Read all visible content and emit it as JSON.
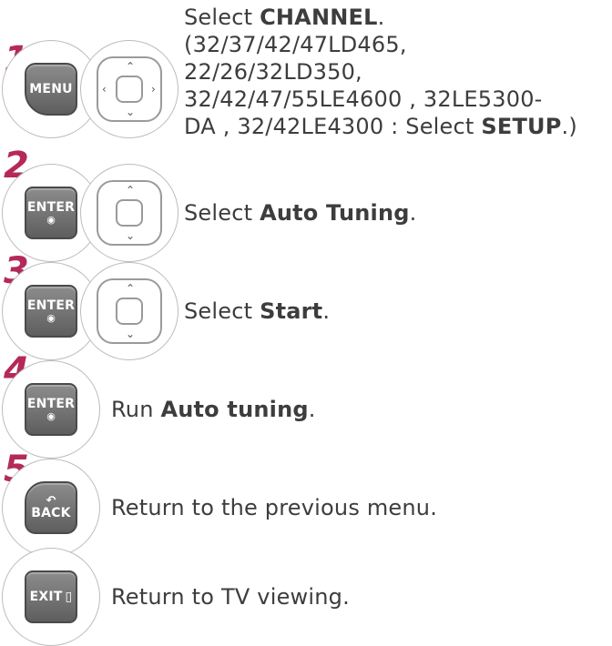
{
  "steps": [
    {
      "number": "1",
      "key": "MENU",
      "line1_pre": "Select ",
      "line1_bold": "CHANNEL",
      "line1_post": ".",
      "note_lines": [
        "(32/37/42/47LD465,",
        "22/26/32LD350,",
        "32/42/47/55LE4600 , 32LE5300-"
      ],
      "last_pre": "DA , 32/42LE4300 : Select ",
      "last_bold": "SETUP",
      "last_post": ".)"
    },
    {
      "number": "2",
      "key": "ENTER",
      "key_dot": "◉",
      "pre": "Select ",
      "bold": "Auto Tuning",
      "post": "."
    },
    {
      "number": "3",
      "key": "ENTER",
      "key_dot": "◉",
      "pre": "Select ",
      "bold": "Start",
      "post": "."
    },
    {
      "number": "4",
      "key": "ENTER",
      "key_dot": "◉",
      "pre": "Run ",
      "bold": "Auto tuning",
      "post": "."
    },
    {
      "number": "5",
      "key": "BACK",
      "text": "Return to the previous menu."
    },
    {
      "key": "EXIT",
      "text": "Return to TV viewing."
    }
  ],
  "icons": {
    "back_symbol": "↶",
    "exit_symbol": "▯"
  },
  "colors": {
    "step_number": "#b5295a",
    "key_fill": "#6e6e6e",
    "text": "#3d3d3d"
  }
}
